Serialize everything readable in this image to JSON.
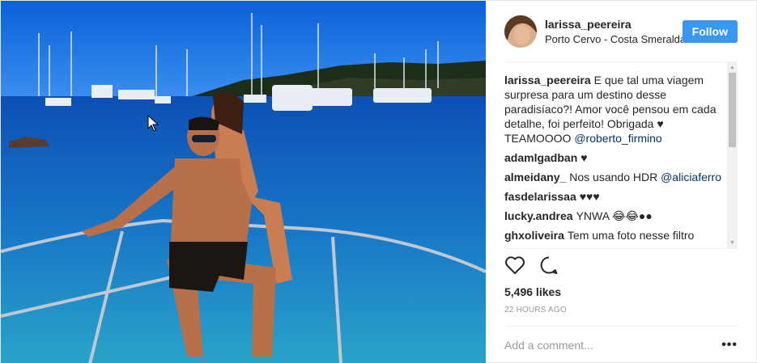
{
  "post": {
    "username": "larissa_peereira",
    "location": "Porto Cervo - Costa Smeralda",
    "follow_label": "Follow",
    "caption": {
      "username": "larissa_peereira",
      "text": "E que tal uma viagem surpresa para um destino desse paradisíaco?! Amor você pensou em cada detalhe, foi perfeito! Obrigada ♥ TEAMOOOO ",
      "mention": "@roberto_firmino"
    },
    "comments": [
      {
        "username": "adamlgadban",
        "text": "♥",
        "mention": ""
      },
      {
        "username": "almeidany_",
        "text": "Nos usando HDR ",
        "mention": "@aliciaferro"
      },
      {
        "username": "fasdelarissaa",
        "text": "♥♥♥",
        "mention": ""
      },
      {
        "username": "lucky.andrea",
        "text": "YNWA 😂😂●●",
        "mention": ""
      },
      {
        "username": "ghxoliveira",
        "text": "Tem uma foto nesse filtro",
        "mention": ""
      }
    ],
    "likes": "5,496 likes",
    "time": "22 HOURS AGO",
    "comment_placeholder": "Add a comment...",
    "more_label": "•••"
  },
  "icons": {
    "like": "heart-icon",
    "comment": "comment-bubble-icon",
    "more": "more-options-icon"
  },
  "colors": {
    "follow_button": "#3897f0",
    "mention": "#003569"
  }
}
